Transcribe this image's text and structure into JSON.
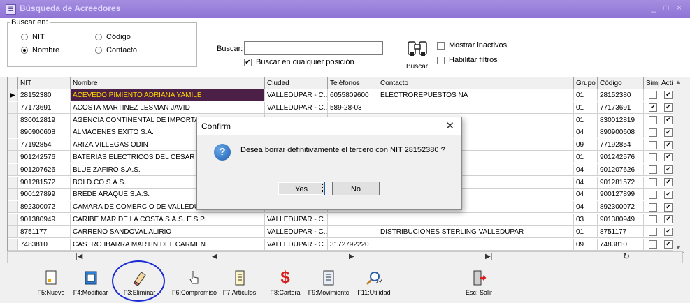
{
  "window": {
    "title": "Búsqueda de Acreedores"
  },
  "search_panel": {
    "group_label": "Buscar en:",
    "radios": [
      {
        "label": "NIT",
        "checked": false
      },
      {
        "label": "Código",
        "checked": false
      },
      {
        "label": "Nombre",
        "checked": true
      },
      {
        "label": "Contacto",
        "checked": false
      }
    ],
    "search_label": "Buscar:",
    "search_value": "",
    "any_position": {
      "label": "Buscar en cualquier posición",
      "checked": true
    },
    "search_button": "Buscar",
    "show_inactive": {
      "label": "Mostrar inactivos",
      "checked": false
    },
    "enable_filters": {
      "label": "Habilitar filtros",
      "checked": false
    }
  },
  "grid": {
    "columns": [
      "NIT",
      "Nombre",
      "Ciudad",
      "Teléfonos",
      "Contacto",
      "Grupo",
      "Código",
      "Simp",
      "Activ"
    ],
    "rows": [
      {
        "nit": "28152380",
        "nombre": "ACEVEDO PIMIENTO ADRIANA YAMILE",
        "ciudad": "VALLEDUPAR - C...",
        "telefono": "6055809600",
        "contacto": "ELECTROREPUESTOS NA",
        "grupo": "01",
        "codigo": "28152380",
        "simp": "",
        "activ": "✔"
      },
      {
        "nit": "77173691",
        "nombre": "ACOSTA MARTINEZ LESMAN JAVID",
        "ciudad": "VALLEDUPAR - C...",
        "telefono": "589-28-03",
        "contacto": "",
        "grupo": "01",
        "codigo": "77173691",
        "simp": "✔",
        "activ": "✔"
      },
      {
        "nit": "830012819",
        "nombre": "AGENCIA CONTINENTAL DE IMPORTACIO",
        "ciudad": "",
        "telefono": "",
        "contacto": "",
        "grupo": "01",
        "codigo": "830012819",
        "simp": "",
        "activ": "✔"
      },
      {
        "nit": "890900608",
        "nombre": "ALMACENES EXITO S.A.",
        "ciudad": "",
        "telefono": "",
        "contacto": "",
        "grupo": "04",
        "codigo": "890900608",
        "simp": "",
        "activ": "✔"
      },
      {
        "nit": "77192854",
        "nombre": "ARIZA VILLEGAS ODIN",
        "ciudad": "",
        "telefono": "",
        "contacto": "",
        "grupo": "09",
        "codigo": "77192854",
        "simp": "",
        "activ": "✔"
      },
      {
        "nit": "901242576",
        "nombre": "BATERIAS ELECTRICOS DEL CESAR LTD",
        "ciudad": "",
        "telefono": "",
        "contacto": "",
        "grupo": "01",
        "codigo": "901242576",
        "simp": "",
        "activ": "✔"
      },
      {
        "nit": "901207626",
        "nombre": "BLUE ZAFIRO S.A.S.",
        "ciudad": "",
        "telefono": "",
        "contacto": "",
        "grupo": "04",
        "codigo": "901207626",
        "simp": "",
        "activ": "✔"
      },
      {
        "nit": "901281572",
        "nombre": "BOLD.CO S.A.S.",
        "ciudad": "",
        "telefono": "",
        "contacto": "",
        "grupo": "04",
        "codigo": "901281572",
        "simp": "",
        "activ": "✔"
      },
      {
        "nit": "900127899",
        "nombre": "BREDE ARAQUE S.A.S.",
        "ciudad": "",
        "telefono": "",
        "contacto": "",
        "grupo": "04",
        "codigo": "900127899",
        "simp": "",
        "activ": "✔"
      },
      {
        "nit": "892300072",
        "nombre": "CAMARA DE COMERCIO DE VALLEDUPAR",
        "ciudad": "",
        "telefono": "",
        "contacto": "",
        "grupo": "04",
        "codigo": "892300072",
        "simp": "",
        "activ": "✔"
      },
      {
        "nit": "901380949",
        "nombre": "CARIBE MAR DE LA COSTA S.A.S. E.S.P.",
        "ciudad": "VALLEDUPAR - C...",
        "telefono": "",
        "contacto": "",
        "grupo": "03",
        "codigo": "901380949",
        "simp": "",
        "activ": "✔"
      },
      {
        "nit": "8751177",
        "nombre": "CARREÑO SANDOVAL ALIRIO",
        "ciudad": "VALLEDUPAR - C...",
        "telefono": "",
        "contacto": "DISTRIBUCIONES STERLING VALLEDUPAR",
        "grupo": "01",
        "codigo": "8751177",
        "simp": "",
        "activ": "✔"
      },
      {
        "nit": "7483810",
        "nombre": "CASTRO IBARRA MARTIN DEL CARMEN",
        "ciudad": "VALLEDUPAR - C...",
        "telefono": "3172792220",
        "contacto": "",
        "grupo": "09",
        "codigo": "7483810",
        "simp": "",
        "activ": "✔"
      }
    ]
  },
  "toolbar": [
    {
      "key": "nuevo",
      "label": "F5:Nuevo",
      "icon": "new-document-icon"
    },
    {
      "key": "modificar",
      "label": "F4:Modificar",
      "icon": "edit-icon"
    },
    {
      "key": "eliminar",
      "label": "F3:Eliminar",
      "icon": "eraser-icon"
    },
    {
      "key": "compromiso",
      "label": "F6:Compromiso",
      "icon": "hand-pointer-icon"
    },
    {
      "key": "articulos",
      "label": "F7:Articulos",
      "icon": "list-icon"
    },
    {
      "key": "cartera",
      "label": "F8:Cartera",
      "icon": "dollar-icon"
    },
    {
      "key": "movimiento",
      "label": "F9:Movimientc",
      "icon": "ledger-icon"
    },
    {
      "key": "utilidad",
      "label": "F11:Utilidad",
      "icon": "magnifier-chart-icon"
    },
    {
      "key": "salir",
      "label": "Esc: Salir",
      "icon": "exit-door-icon"
    }
  ],
  "dialog": {
    "title": "Confirm",
    "message": "Desea borrar definitivamente el tercero con NIT 28152380 ?",
    "yes": "Yes",
    "no": "No"
  },
  "colors": {
    "selection_bg": "#4c1f47",
    "selection_fg": "#ffd700",
    "annotation_circle": "#1a2bd6"
  }
}
